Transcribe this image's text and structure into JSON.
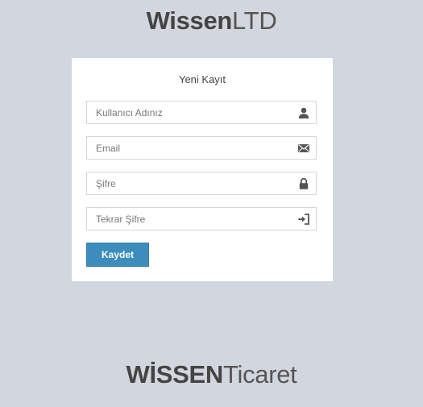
{
  "header": {
    "logo_bold": "Wissen",
    "logo_light": "LTD"
  },
  "form": {
    "title": "Yeni Kayıt",
    "fields": [
      {
        "placeholder": "Kullanıcı Adınız",
        "icon": "user-icon"
      },
      {
        "placeholder": "Email",
        "icon": "envelope-icon"
      },
      {
        "placeholder": "Şifre",
        "icon": "lock-icon"
      },
      {
        "placeholder": "Tekrar Şifre",
        "icon": "sign-in-icon"
      }
    ],
    "submit_label": "Kaydet"
  },
  "footer": {
    "logo_bold": "WİSSEN",
    "logo_light": "Ticaret"
  },
  "colors": {
    "background": "#d2d6de",
    "primary": "#3c8dbc",
    "text": "#444444"
  }
}
